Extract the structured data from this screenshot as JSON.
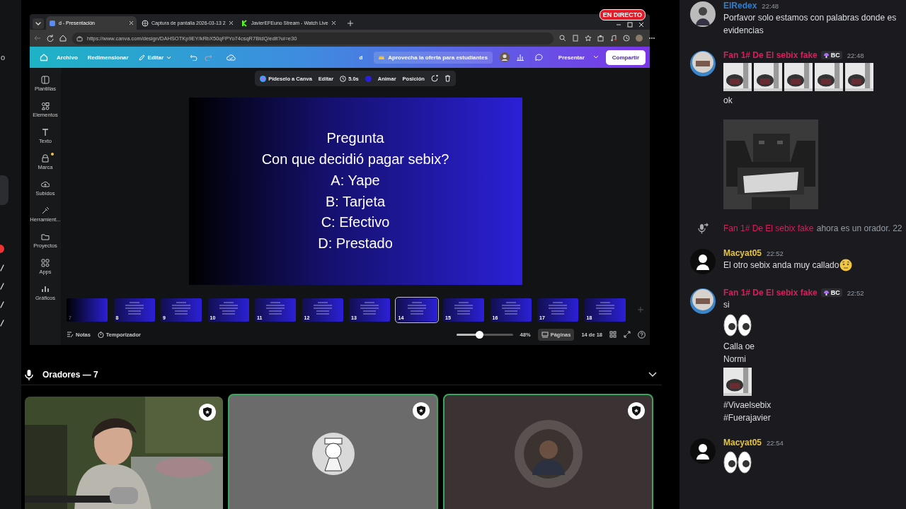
{
  "left_strip": {
    "text": "o"
  },
  "live_badge": "EN DIRECTO",
  "browser": {
    "tabs": [
      {
        "label": "d - Presentación",
        "selected": true
      },
      {
        "label": "Captura de pantalla 2026-03-13 2",
        "selected": false
      },
      {
        "label": "JavierEFEuno Stream - Watch Live",
        "selected": false
      }
    ],
    "url": "https://www.canva.com/design/DAHSOTKp9EY/kRbX50qFPYo74csqR7BtdQ/edit?ui=e30"
  },
  "canva": {
    "menu": [
      {
        "label": "Archivo",
        "kind": "plain"
      },
      {
        "label": "Redimensionar",
        "kind": "plain"
      },
      {
        "label": "Editar",
        "kind": "dropdown"
      }
    ],
    "doc_title": "d",
    "promo": "Aprovecha la oferta para estudiantes",
    "present": "Presentar",
    "share": "Compartir",
    "tools": [
      "Plantillas",
      "Elementos",
      "Texto",
      "Marca",
      "Subidos",
      "Herramient...",
      "Proyectos",
      "Apps",
      "Gráficos"
    ],
    "context_toolbar": {
      "ai": "Pídeselo a Canva",
      "edit": "Editar",
      "duration": "5.0s",
      "animate": "Animar",
      "position": "Posición"
    },
    "slide_lines": [
      "Pregunta",
      "Con que decidió pagar sebix?",
      "A: Yape",
      "B: Tarjeta",
      "C: Efectivo",
      "D: Prestado"
    ],
    "pages": [
      {
        "number": "7",
        "selected": false
      },
      {
        "number": "8",
        "selected": false
      },
      {
        "number": "9",
        "selected": false
      },
      {
        "number": "10",
        "selected": false
      },
      {
        "number": "11",
        "selected": false
      },
      {
        "number": "12",
        "selected": false
      },
      {
        "number": "13",
        "selected": false
      },
      {
        "number": "14",
        "selected": true
      },
      {
        "number": "15",
        "selected": false
      },
      {
        "number": "16",
        "selected": false
      },
      {
        "number": "17",
        "selected": false
      },
      {
        "number": "18",
        "selected": false
      }
    ],
    "notes": "Notas",
    "timer": "Temporizador",
    "zoom": {
      "level": 0.4,
      "reading": "48%"
    },
    "pages_button": "Páginas",
    "page_count": "14 de 18"
  },
  "speakers": {
    "title": "Oradores — 7",
    "tiles": [
      {
        "kind": "video",
        "speaking": false
      },
      {
        "kind": "avatar",
        "speaking": true
      },
      {
        "kind": "avatar",
        "speaking": true
      }
    ]
  },
  "chat": {
    "messages": [
      {
        "kind": "message",
        "author": "ElRedex",
        "color": "#2f7fd1",
        "time": "22:48",
        "content": [
          {
            "kind": "text",
            "text": "Porfavor solo estamos con palabras donde es"
          },
          {
            "kind": "text",
            "text": "evidencias"
          }
        ]
      },
      {
        "kind": "message",
        "author": "Fan 1# De El sebix fake",
        "color": "#d61f5b",
        "badge": "BC",
        "time": "22:48",
        "content": [
          {
            "kind": "sticker_row"
          },
          {
            "kind": "text",
            "text": "ok"
          },
          {
            "kind": "picture_large"
          }
        ]
      },
      {
        "kind": "system",
        "author": "Fan 1# De El sebix fake",
        "color": "#d61f5b",
        "text": "ahora es un orador. 22"
      },
      {
        "kind": "message",
        "author": "Macyat05",
        "color": "#e3c33f",
        "time": "22:52",
        "content": [
          {
            "kind": "text",
            "text": "El otro sebix anda muy callado",
            "emoji": true
          }
        ]
      },
      {
        "kind": "message",
        "author": "Fan 1# De El sebix fake",
        "color": "#d61f5b",
        "badge": "BC",
        "time": "22:52",
        "content": [
          {
            "kind": "text",
            "text": "si"
          },
          {
            "kind": "eyes"
          },
          {
            "kind": "text",
            "text": "Calla oe"
          },
          {
            "kind": "text",
            "text": "Normi"
          },
          {
            "kind": "picture_small"
          },
          {
            "kind": "text",
            "text": "#Vivaelsebix"
          },
          {
            "kind": "text",
            "text": "#Fuerajavier"
          }
        ]
      },
      {
        "kind": "message",
        "author": "Macyat05",
        "color": "#e3c33f",
        "time": "22:54",
        "content": [
          {
            "kind": "eyes"
          }
        ]
      }
    ]
  }
}
